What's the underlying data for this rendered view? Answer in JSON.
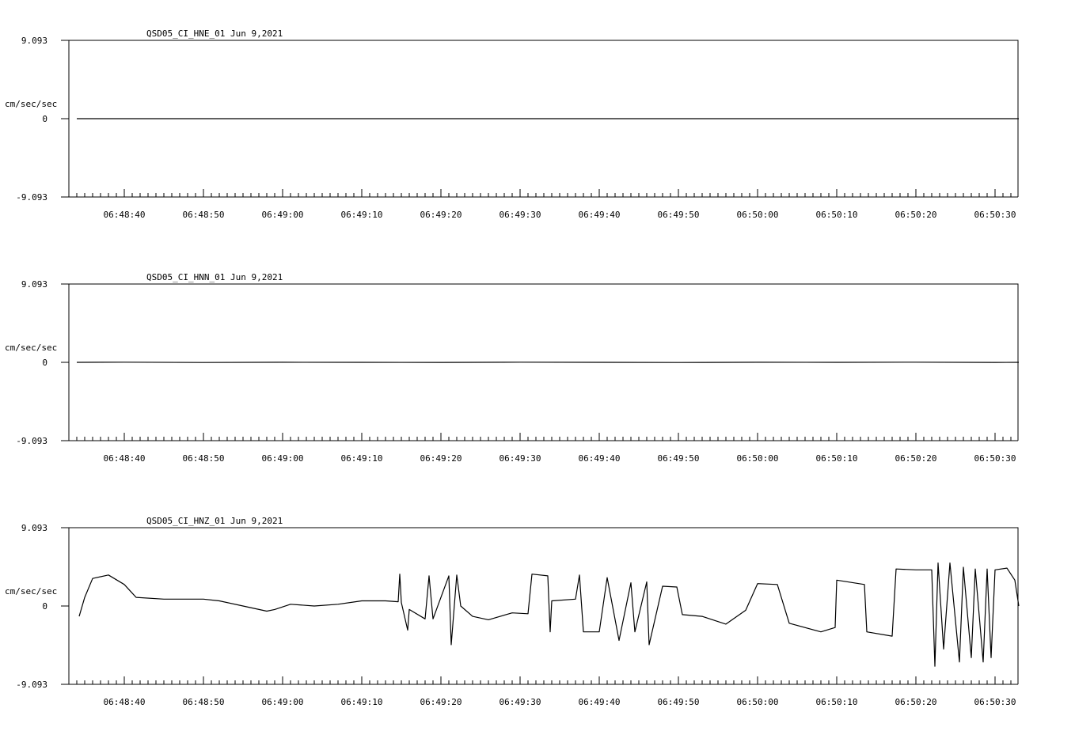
{
  "chart_data": [
    {
      "type": "line",
      "title": "QSD05_CI_HNE_01  Jun 9,2021",
      "ylabel": "cm/sec/sec",
      "ylim": [
        -9.093,
        9.093
      ],
      "y_tick_labels": [
        "9.093",
        "0",
        "-9.093"
      ],
      "x_tick_labels": [
        "06:48:40",
        "06:48:50",
        "06:49:00",
        "06:49:10",
        "06:49:20",
        "06:49:30",
        "06:49:40",
        "06:49:50",
        "06:50:00",
        "06:50:10",
        "06:50:20",
        "06:50:30"
      ],
      "series": [
        {
          "x": [
            "06:48:34",
            "06:48:40",
            "06:48:50",
            "06:49:00",
            "06:49:10",
            "06:49:20",
            "06:49:30",
            "06:49:40",
            "06:49:50",
            "06:50:00",
            "06:50:10",
            "06:50:20",
            "06:50:30",
            "06:50:33"
          ],
          "values": [
            0,
            0,
            0,
            0,
            0,
            0,
            0,
            0,
            0,
            0,
            0,
            0,
            0,
            0
          ]
        }
      ]
    },
    {
      "type": "line",
      "title": "QSD05_CI_HNN_01  Jun 9,2021",
      "ylabel": "cm/sec/sec",
      "ylim": [
        -9.093,
        9.093
      ],
      "y_tick_labels": [
        "9.093",
        "0",
        "-9.093"
      ],
      "x_tick_labels": [
        "06:48:40",
        "06:48:50",
        "06:49:00",
        "06:49:10",
        "06:49:20",
        "06:49:30",
        "06:49:40",
        "06:49:50",
        "06:50:00",
        "06:50:10",
        "06:50:20",
        "06:50:30"
      ],
      "series": [
        {
          "x": [
            "06:48:34",
            "06:48:40",
            "06:48:50",
            "06:49:00",
            "06:49:10",
            "06:49:20",
            "06:49:30",
            "06:49:40",
            "06:49:50",
            "06:50:00",
            "06:50:10",
            "06:50:20",
            "06:50:30",
            "06:50:33"
          ],
          "values": [
            0,
            0.02,
            -0.02,
            0.01,
            0,
            -0.01,
            0.02,
            0,
            -0.02,
            0.01,
            0,
            0.02,
            -0.01,
            0
          ]
        }
      ]
    },
    {
      "type": "line",
      "title": "QSD05_CI_HNZ_01  Jun 9,2021",
      "ylabel": "cm/sec/sec",
      "ylim": [
        -9.093,
        9.093
      ],
      "y_tick_labels": [
        "9.093",
        "0",
        "-9.093"
      ],
      "x_tick_labels": [
        "06:48:40",
        "06:48:50",
        "06:49:00",
        "06:49:10",
        "06:49:20",
        "06:49:30",
        "06:49:40",
        "06:49:50",
        "06:50:00",
        "06:50:10",
        "06:50:20",
        "06:50:30"
      ],
      "series": [
        {
          "x": [
            "06:48:34.3",
            "06:48:35.0",
            "06:48:36.0",
            "06:48:38.0",
            "06:48:40.0",
            "06:48:41.0",
            "06:48:41.5",
            "06:48:45.0",
            "06:48:50.0",
            "06:48:52.0",
            "06:48:55.0",
            "06:48:58.0",
            "06:48:59.0",
            "06:49:01.0",
            "06:49:04.0",
            "06:49:07.0",
            "06:49:10.0",
            "06:49:13.0",
            "06:49:14.6",
            "06:49:14.8",
            "06:49:15.0",
            "06:49:15.8",
            "06:49:16.0",
            "06:49:18.0",
            "06:49:18.5",
            "06:49:19.0",
            "06:49:21.0",
            "06:49:21.3",
            "06:49:22.0",
            "06:49:22.5",
            "06:49:24.0",
            "06:49:26.0",
            "06:49:29.0",
            "06:49:31.0",
            "06:49:31.5",
            "06:49:33.5",
            "06:49:33.8",
            "06:49:34.0",
            "06:49:37.0",
            "06:49:37.5",
            "06:49:38.0",
            "06:49:40.0",
            "06:49:41.0",
            "06:49:42.5",
            "06:49:44.0",
            "06:49:44.5",
            "06:49:46.0",
            "06:49:46.3",
            "06:49:48.0",
            "06:49:49.8",
            "06:49:50.5",
            "06:49:53.0",
            "06:49:56.0",
            "06:49:58.5",
            "06:50:00.0",
            "06:50:02.5",
            "06:50:04.0",
            "06:50:08.0",
            "06:50:09.8",
            "06:50:10.0",
            "06:50:13.5",
            "06:50:13.8",
            "06:50:17.0",
            "06:50:17.5",
            "06:50:20.0",
            "06:50:22.0",
            "06:50:22.4",
            "06:50:22.8",
            "06:50:23.5",
            "06:50:24.3",
            "06:50:25.5",
            "06:50:26.0",
            "06:50:27.0",
            "06:50:27.5",
            "06:50:28.5",
            "06:50:29.0",
            "06:50:29.5",
            "06:50:30.0",
            "06:50:31.5",
            "06:50:32.5",
            "06:50:33.0"
          ],
          "values": [
            -1.2,
            1.0,
            3.2,
            3.6,
            2.5,
            1.5,
            1.0,
            0.8,
            0.8,
            0.6,
            0.0,
            -0.6,
            -0.4,
            0.2,
            0.0,
            0.2,
            0.6,
            0.6,
            0.5,
            3.7,
            0.4,
            -2.8,
            -0.4,
            -1.5,
            3.5,
            -1.5,
            3.5,
            -4.5,
            3.6,
            0.0,
            -1.2,
            -1.6,
            -0.8,
            -0.9,
            3.7,
            3.5,
            -3.0,
            0.6,
            0.8,
            3.6,
            -3.0,
            -3.0,
            3.3,
            -4.0,
            2.7,
            -3.0,
            2.8,
            -4.5,
            2.3,
            2.2,
            -1.0,
            -1.2,
            -2.1,
            -0.5,
            2.6,
            2.5,
            -2.0,
            -3.0,
            -2.5,
            3.0,
            2.5,
            -3.0,
            -3.5,
            4.3,
            4.2,
            4.2,
            -7.0,
            5.0,
            -5.0,
            5.0,
            -6.5,
            4.5,
            -6.0,
            4.3,
            -6.5,
            4.3,
            -6.0,
            4.2,
            4.4,
            3.0,
            0.0
          ]
        }
      ]
    }
  ]
}
